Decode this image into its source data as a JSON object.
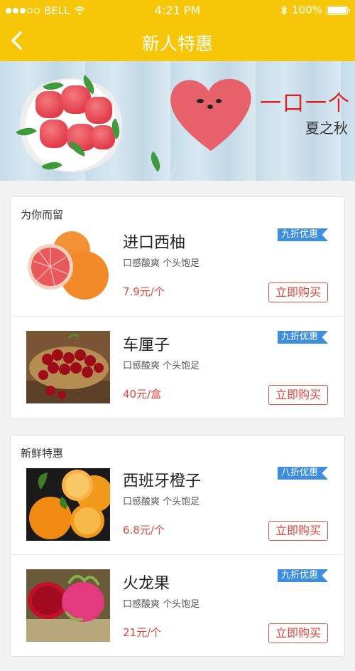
{
  "status_bar": {
    "carrier": "BELL",
    "time": "4:21 PM",
    "battery": "100%",
    "battery_level": 1.0
  },
  "nav": {
    "title": "新人特惠",
    "back_icon": "chevron-left-icon"
  },
  "banner": {
    "slogan": "一口一个",
    "sub": "夏之秋"
  },
  "sections": [
    {
      "title": "为你而留",
      "items": [
        {
          "name": "进口西柚",
          "desc": "口感酸爽  个头饱足",
          "price": "7.9元/个",
          "badge": "九折优惠",
          "buy": "立即购买"
        },
        {
          "name": "车厘子",
          "desc": "口感酸爽  个头饱足",
          "price": "40元/盒",
          "badge": "九折优惠",
          "buy": "立即购买"
        }
      ]
    },
    {
      "title": "新鲜特惠",
      "items": [
        {
          "name": "西班牙橙子",
          "desc": "口感酸爽  个头饱足",
          "price": "6.8元/个",
          "badge": "八折优惠",
          "buy": "立即购买"
        },
        {
          "name": "火龙果",
          "desc": "口感酸爽  个头饱足",
          "price": "21元/个",
          "badge": "九折优惠",
          "buy": "立即购买"
        }
      ]
    }
  ],
  "colors": {
    "header": "#f7c608",
    "accent_red": "#e0453c",
    "badge_blue": "#3d8de0"
  }
}
